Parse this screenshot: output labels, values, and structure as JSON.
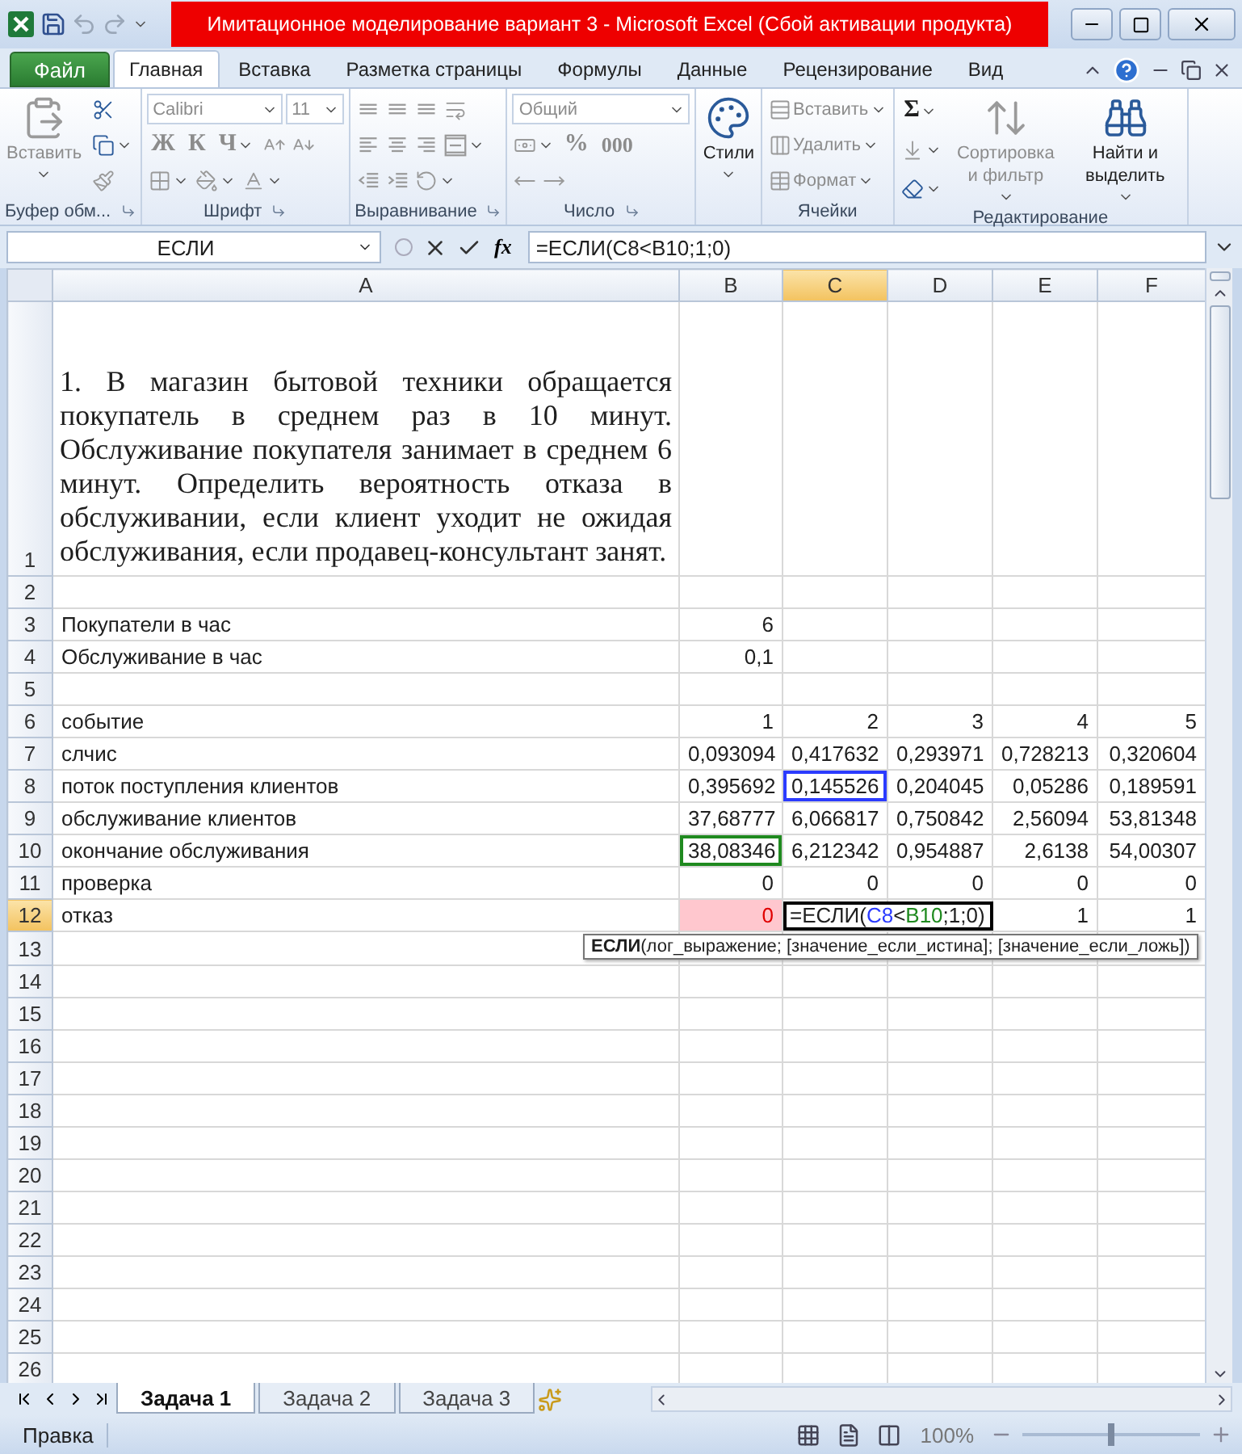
{
  "window": {
    "title": "Имитационное моделирование вариант 3  -  Microsoft Excel (Сбой активации продукта)"
  },
  "file_tab": "Файл",
  "ribbon_tabs": [
    {
      "label": "Главная",
      "selected": true
    },
    {
      "label": "Вставка",
      "selected": false
    },
    {
      "label": "Разметка страницы",
      "selected": false
    },
    {
      "label": "Формулы",
      "selected": false
    },
    {
      "label": "Данные",
      "selected": false
    },
    {
      "label": "Рецензирование",
      "selected": false
    },
    {
      "label": "Вид",
      "selected": false
    }
  ],
  "ribbon_groups": [
    {
      "label": "Буфер обм...",
      "launcher": true,
      "columns": [
        {
          "kind": "large",
          "label": "Вставить",
          "menu": true,
          "disabled": true
        },
        {
          "kind": "stack",
          "lines": [
            [
              {
                "kind": "icon",
                "menu": false,
                "disabled": false
              }
            ],
            [
              {
                "kind": "icon",
                "menu": true,
                "disabled": false
              }
            ],
            [
              {
                "kind": "icon",
                "menu": false,
                "disabled": true
              }
            ]
          ]
        }
      ]
    },
    {
      "label": "Шрифт",
      "launcher": true,
      "columns": [
        {
          "kind": "stack",
          "lines": [
            [
              {
                "kind": "combo",
                "label": "Calibri",
                "menu": true,
                "disabled": true
              },
              {
                "kind": "combo",
                "label": "11",
                "menu": true,
                "disabled": true
              }
            ],
            [
              {
                "kind": "glyph",
                "label": "Ж",
                "menu": false,
                "disabled": true
              },
              {
                "kind": "glyph",
                "label": "К",
                "menu": false,
                "disabled": true
              },
              {
                "kind": "glyph",
                "label": "Ч",
                "menu": true,
                "disabled": true
              },
              {
                "kind": "icon",
                "menu": false,
                "disabled": true
              },
              {
                "kind": "icon",
                "menu": false,
                "disabled": true
              }
            ],
            [
              {
                "kind": "icon",
                "menu": true,
                "disabled": true
              },
              {
                "kind": "icon",
                "menu": true,
                "disabled": true
              },
              {
                "kind": "icon",
                "menu": true,
                "disabled": true
              }
            ]
          ]
        }
      ]
    },
    {
      "label": "Выравнивание",
      "launcher": true,
      "columns": [
        {
          "kind": "stack",
          "lines": [
            [
              {
                "kind": "icon",
                "menu": false,
                "disabled": true
              },
              {
                "kind": "icon",
                "menu": false,
                "disabled": true
              },
              {
                "kind": "icon",
                "menu": false,
                "disabled": true
              },
              {
                "kind": "icon",
                "menu": false,
                "disabled": true
              }
            ],
            [
              {
                "kind": "icon",
                "menu": false,
                "disabled": true
              },
              {
                "kind": "icon",
                "menu": false,
                "disabled": true
              },
              {
                "kind": "icon",
                "menu": false,
                "disabled": true
              },
              {
                "kind": "icon",
                "menu": true,
                "disabled": true
              }
            ],
            [
              {
                "kind": "icon",
                "menu": false,
                "disabled": true
              },
              {
                "kind": "icon",
                "menu": false,
                "disabled": true
              },
              {
                "kind": "icon",
                "menu": true,
                "disabled": true
              }
            ]
          ]
        }
      ]
    },
    {
      "label": "Число",
      "launcher": true,
      "columns": [
        {
          "kind": "stack",
          "lines": [
            [
              {
                "kind": "combo",
                "label": "Общий",
                "menu": true,
                "disabled": true
              }
            ],
            [
              {
                "kind": "icon",
                "menu": true,
                "disabled": true
              },
              {
                "kind": "glyph",
                "label": "%",
                "menu": false,
                "disabled": true
              },
              {
                "kind": "glyph",
                "label": "000",
                "menu": false,
                "disabled": true
              }
            ],
            [
              {
                "kind": "icon",
                "menu": false,
                "disabled": true
              },
              {
                "kind": "icon",
                "menu": false,
                "disabled": true
              }
            ]
          ]
        }
      ]
    },
    {
      "launcher": false,
      "columns": [
        {
          "kind": "large",
          "label": "Стили",
          "menu": true,
          "disabled": false
        }
      ]
    },
    {
      "label": "Ячейки",
      "launcher": false,
      "columns": [
        {
          "kind": "stack",
          "lines": [
            [
              {
                "kind": "small",
                "label": "Вставить",
                "menu": true,
                "disabled": true
              }
            ],
            [
              {
                "kind": "small",
                "label": "Удалить",
                "menu": true,
                "disabled": true
              }
            ],
            [
              {
                "kind": "small",
                "label": "Формат",
                "menu": true,
                "disabled": true
              }
            ]
          ]
        }
      ]
    },
    {
      "label": "Редактирование",
      "launcher": false,
      "columns": [
        {
          "kind": "stack",
          "lines": [
            [
              {
                "kind": "glyph",
                "label": "Σ",
                "menu": true,
                "disabled": false
              }
            ],
            [
              {
                "kind": "icon",
                "menu": true,
                "disabled": true
              }
            ],
            [
              {
                "kind": "icon",
                "menu": true,
                "disabled": false
              }
            ]
          ]
        },
        {
          "kind": "large",
          "label": "Сортировка и фильтр",
          "menu": true,
          "disabled": true
        },
        {
          "kind": "large",
          "label": "Найти и выделить",
          "menu": true,
          "disabled": false
        }
      ]
    }
  ],
  "formula_bar": {
    "name_box": "ЕСЛИ",
    "function_label": "fx",
    "formula": "=ЕСЛИ(C8<B10;1;0)"
  },
  "columns": [
    {
      "label": "A",
      "selected": false
    },
    {
      "label": "B",
      "selected": false
    },
    {
      "label": "C",
      "selected": true
    },
    {
      "label": "D",
      "selected": false
    },
    {
      "label": "E",
      "selected": false
    },
    {
      "label": "F",
      "selected": false
    }
  ],
  "rows": [
    {
      "number": "1",
      "selected": false,
      "cells": [
        {
          "kind": "paragraph",
          "text": "1. В магазин бытовой техники обращается покупатель в среднем раз в 10 минут. Обслуживание покупателя занимает в среднем 6 минут. Определить вероятность отказа в обслуживании, если клиент уходит не ожидая обслуживания, если продавец-консультант занят."
        }
      ]
    },
    {
      "number": "2",
      "selected": false
    },
    {
      "number": "3",
      "selected": false,
      "cells": [
        "Покупатели в час",
        "6"
      ]
    },
    {
      "number": "4",
      "selected": false,
      "cells": [
        "Обслуживание в час",
        "0,1"
      ]
    },
    {
      "number": "5",
      "selected": false
    },
    {
      "number": "6",
      "selected": false,
      "cells": [
        "событие",
        "1",
        "2",
        "3",
        "4",
        "5"
      ]
    },
    {
      "number": "7",
      "selected": false,
      "cells": [
        "слчис",
        "0,093094",
        "0,417632",
        "0,293971",
        "0,728213",
        "0,320604"
      ]
    },
    {
      "number": "8",
      "selected": false,
      "cells": [
        "поток поступления клиентов",
        "0,395692",
        {
          "kind": "value",
          "text": "0,145526",
          "color": "#2b3bff"
        },
        "0,204045",
        "0,05286",
        "0,189591"
      ]
    },
    {
      "number": "9",
      "selected": false,
      "cells": [
        "обслуживание клиентов",
        "37,68777",
        "6,066817",
        "0,750842",
        "2,56094",
        "53,81348"
      ]
    },
    {
      "number": "10",
      "selected": false,
      "cells": [
        "окончание обслуживания",
        {
          "kind": "value",
          "text": "38,08346",
          "color": "#1f8a1f"
        },
        "6,212342",
        "0,954887",
        "2,6138",
        "54,00307"
      ]
    },
    {
      "number": "11",
      "selected": false,
      "cells": [
        "проверка",
        "0",
        "0",
        "0",
        "0",
        "0"
      ]
    },
    {
      "number": "12",
      "selected": true,
      "cells": [
        "отказ",
        {
          "kind": "value",
          "text": "0",
          "highlight": true
        },
        {
          "kind": "editor",
          "parts": [
            {
              "text": "=ЕСЛИ("
            },
            {
              "text": "C8",
              "color": "#2b3bff"
            },
            {
              "text": "<"
            },
            {
              "text": "B10",
              "color": "#1f8a1f"
            },
            {
              "text": ";1;0)"
            }
          ]
        },
        null,
        "1",
        "1"
      ]
    },
    {
      "number": "13",
      "selected": false
    },
    {
      "number": "14",
      "selected": false
    },
    {
      "number": "15",
      "selected": false
    },
    {
      "number": "16",
      "selected": false
    },
    {
      "number": "17",
      "selected": false
    },
    {
      "number": "18",
      "selected": false
    },
    {
      "number": "19",
      "selected": false
    },
    {
      "number": "20",
      "selected": false
    },
    {
      "number": "21",
      "selected": false
    },
    {
      "number": "22",
      "selected": false
    },
    {
      "number": "23",
      "selected": false
    },
    {
      "number": "24",
      "selected": false
    },
    {
      "number": "25",
      "selected": false
    },
    {
      "number": "26",
      "selected": false
    }
  ],
  "tooltip": "**ЕСЛИ**(лог_выражение; [значение_если_истина]; [значение_если_ложь])",
  "sheet_tabs": [
    {
      "label": "Задача 1",
      "selected": true
    },
    {
      "label": "Задача 2",
      "selected": false
    },
    {
      "label": "Задача 3",
      "selected": false
    }
  ],
  "status_bar": {
    "mode": "Правка",
    "zoom": "100%",
    "zoom_slider": {
      "level": 0.5
    }
  }
}
